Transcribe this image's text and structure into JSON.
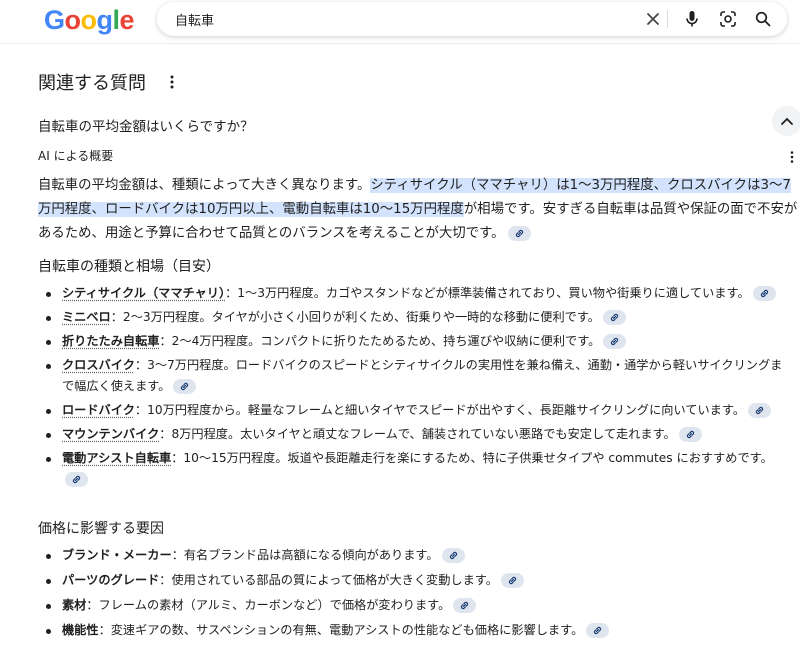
{
  "header": {
    "logo_letters": [
      "G",
      "o",
      "o",
      "g",
      "l",
      "e"
    ],
    "logo_colors": [
      "#4285F4",
      "#EA4335",
      "#FBBC05",
      "#4285F4",
      "#34A853",
      "#EA4335"
    ],
    "search_query": "自転車",
    "icons": [
      "close-icon",
      "mic-icon",
      "lens-icon",
      "search-icon"
    ]
  },
  "section": {
    "title": "関連する質問"
  },
  "question": {
    "text": "自転車の平均金額はいくらですか？"
  },
  "ai": {
    "label": "AI による概要",
    "summary_before": "自転車の平均金額は、種類によって大きく異なります。",
    "summary_highlight": "シティサイクル（ママチャリ）は1〜3万円程度、クロスバイクは3〜7万円程度、ロードバイクは10万円以上、電動自転車は10〜15万円程度",
    "summary_after": "が相場です。安すぎる自転車は品質や保証の面で不安があるため、用途と予算に合わせて品質とのバランスを考えることが大切です。"
  },
  "types": {
    "heading": "自転車の種類と相場（目安）",
    "items": [
      {
        "term": "シティサイクル（ママチャリ）",
        "text": "：1〜3万円程度。カゴやスタンドなどが標準装備されており、買い物や街乗りに適しています。"
      },
      {
        "term": "ミニベロ",
        "text": "：2〜3万円程度。タイヤが小さく小回りが利くため、街乗りや一時的な移動に便利です。"
      },
      {
        "term": "折りたたみ自転車",
        "text": "：2〜4万円程度。コンパクトに折りたためるため、持ち運びや収納に便利です。"
      },
      {
        "term": "クロスバイク",
        "text": "：3〜7万円程度。ロードバイクのスピードとシティサイクルの実用性を兼ね備え、通勤・通学から軽いサイクリングまで幅広く使えます。"
      },
      {
        "term": "ロードバイク",
        "text": "：10万円程度から。軽量なフレームと細いタイヤでスピードが出やすく、長距離サイクリングに向いています。"
      },
      {
        "term": "マウンテンバイク",
        "text": "：8万円程度。太いタイヤと頑丈なフレームで、舗装されていない悪路でも安定して走れます。"
      },
      {
        "term": "電動アシスト自転車",
        "text": "：10〜15万円程度。坂道や長距離走行を楽にするため、特に子供乗せタイプや commutes におすすめです。"
      }
    ]
  },
  "factors": {
    "heading": "価格に影響する要因",
    "items": [
      {
        "term": "ブランド・メーカー",
        "text": "：有名ブランド品は高額になる傾向があります。"
      },
      {
        "term": "パーツのグレード",
        "text": "：使用されている部品の質によって価格が大きく変動します。"
      },
      {
        "term": "素材",
        "text": "：フレームの素材（アルミ、カーボンなど）で価格が変わります。"
      },
      {
        "term": "機能性",
        "text": "：変速ギアの数、サスペンションの有無、電動アシストの性能なども価格に影響します。"
      }
    ]
  }
}
